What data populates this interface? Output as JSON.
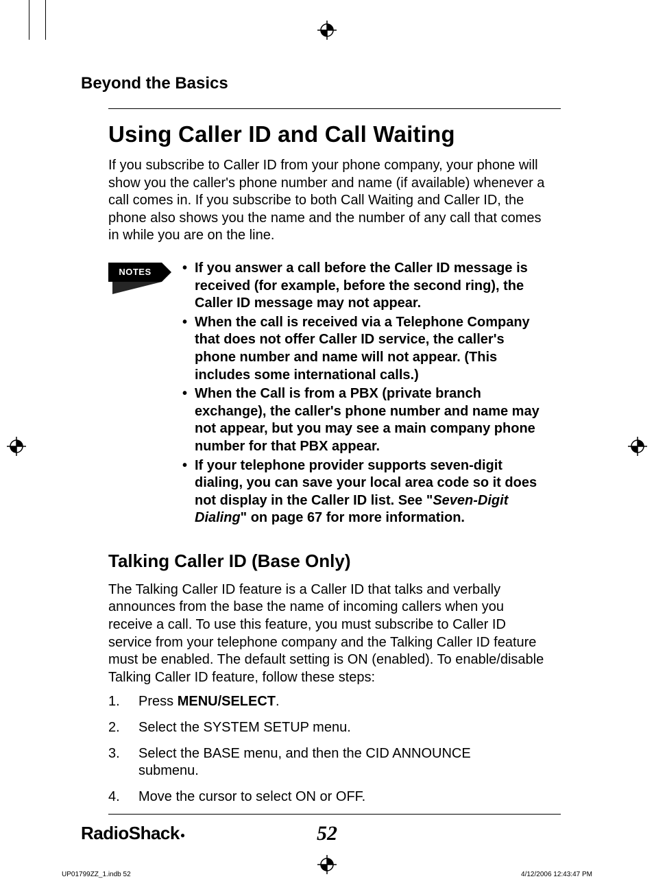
{
  "section_label": "Beyond the Basics",
  "main_heading": "Using Caller ID and Call Waiting",
  "intro": "If you subscribe to Caller ID from your phone company, your phone will show you the caller's phone number and name (if available) whenever a call comes in. If you subscribe to both Call Waiting and Caller ID, the phone also shows you the name and the number of any call that comes in while you are on the line.",
  "notes_label": "NOTES",
  "notes": [
    "If you answer a call before the Caller ID message is received (for example, before the second ring), the Caller ID message may not appear.",
    "When the call is received via a Telephone Company that does not offer Caller ID service, the caller's phone number and name will not appear. (This includes some international calls.)",
    "When the Call is from a PBX (private branch exchange), the caller's phone number and name may not appear, but you may see a main company phone number for that PBX appear."
  ],
  "note4_prefix": "If your telephone provider supports seven-digit dialing, you can save your local area code so it does not display in the Caller ID list. See \"",
  "note4_em": "Seven-Digit Dialing",
  "note4_suffix": "\" on page 67 for more information.",
  "sub_heading": "Talking Caller ID (Base Only)",
  "talking_para": "The Talking Caller ID feature is a Caller ID that talks and verbally announces from the base the name of incoming callers when you receive a call. To use this feature, you must subscribe to Caller ID service from your telephone company and the Talking Caller ID feature must be enabled. The default setting is ON (enabled). To enable/disable Talking Caller ID feature, follow these steps:",
  "step1_prefix": "Press ",
  "step1_bold": "MENU/SELECT",
  "step1_suffix": ".",
  "steps_rest": [
    "Select the SYSTEM SETUP menu.",
    "Select the BASE menu, and then the CID ANNOUNCE submenu.",
    "Move the cursor to select ON or OFF."
  ],
  "brand": "RadioShack",
  "page_number": "52",
  "print_left": "UP01799ZZ_1.indb   52",
  "print_right": "4/12/2006   12:43:47 PM"
}
